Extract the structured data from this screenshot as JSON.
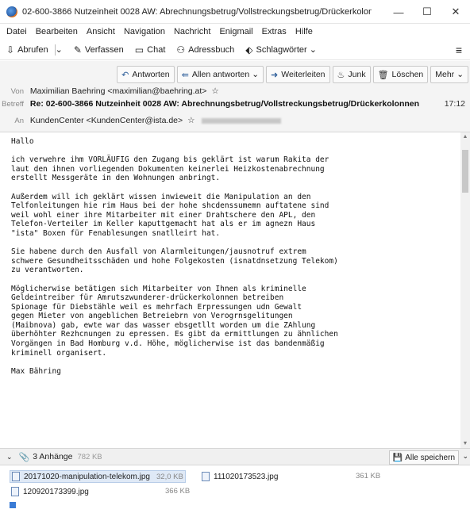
{
  "window": {
    "title": "02-600-3866 Nutzeinheit 0028 AW: Abrechnungsbetrug/Vollstreckungsbetrug/Drückerkolonnen ...",
    "minimize": "—",
    "maximize": "☐",
    "close": "✕"
  },
  "menu": [
    {
      "label": "Datei"
    },
    {
      "label": "Bearbeiten"
    },
    {
      "label": "Ansicht"
    },
    {
      "label": "Navigation"
    },
    {
      "label": "Nachricht"
    },
    {
      "label": "Enigmail"
    },
    {
      "label": "Extras"
    },
    {
      "label": "Hilfe"
    }
  ],
  "toolbar": {
    "get": "Abrufen",
    "compose": "Verfassen",
    "chat": "Chat",
    "addressbook": "Adressbuch",
    "tags": "Schlagwörter",
    "menu_icon": "≡"
  },
  "actions": {
    "reply": "Antworten",
    "reply_all": "Allen antworten",
    "forward": "Weiterleiten",
    "junk": "Junk",
    "delete": "Löschen",
    "more": "Mehr"
  },
  "header": {
    "from_label": "Von",
    "from": "Maximilian Baehring <maximilian@baehring.at>",
    "subject_label": "Betreff",
    "subject": "Re: 02-600-3866 Nutzeinheit 0028 AW: Abrechnungsbetrug/Vollstreckungsbetrug/Drückerkolonnen",
    "time": "17:12",
    "to_label": "An",
    "to": "KundenCenter <KundenCenter@ista.de>"
  },
  "body": {
    "text": "Hallo\n\nich verwehre ihm VORLÄUFIG den Zugang bis geklärt ist warum Rakita der\nlaut den ihnen vorliegenden Dokumenten keinerlei Heizkostenabrechnung\nerstellt Messgeräte in den Wohnungen anbringt.\n\nAußerdem will ich geklärt wissen inwieweit die Manipulation an den\nTelfonleitungen hie rim Haus bei der hohe shcdenssumemn auftatene sind\nweil wohl einer ihre Mitarbeiter mit einer Drahtschere den APL, den\nTelefon-Verteiler im Keller kaputtgemacht hat als er im agnezn Haus\n\"ista\" Boxen für Fenablesungen snatlleirt hat.\n\nSie habene durch den Ausfall von Alarmleitungen/jausnotruf extrem\nschwere Gesundheitsschäden und hohe Folgekosten (isnatdnsetzung Telekom)\nzu verantworten.\n\nMöglicherwise betätigen sich Mitarbeiter von Ihnen als kriminelle\nGeldeintreiber für Amrutszwunderer-drückerkolonnen betreiben\nSpionage für Diebstähle weil es mehrfach Erpressungen udn Gewalt\ngegen Mieter von angeblichen Betreiebrn von Verogrnsgelitungen\n(Maibnova) gab, ewte war das wasser ebsgetllt worden um die ZAhlung\nüberhöhter Rezhcnungen zu epressen. Es gibt da ermittlungen zu ähnlichen\nVorgängen in Bad Homburg v.d. Höhe, möglicherwise ist das bandenmäßig\nkriminell organisert.\n\nMax Bähring"
  },
  "attachments": {
    "count_label": "3 Anhänge",
    "total_size": "782 KB",
    "save_all": "Alle speichern",
    "items": [
      {
        "name": "20171020-manipulation-telekom.jpg",
        "size": "32,0 KB"
      },
      {
        "name": "111020173523.jpg",
        "size": "361 KB"
      },
      {
        "name": "120920173399.jpg",
        "size": "366 KB"
      }
    ]
  }
}
